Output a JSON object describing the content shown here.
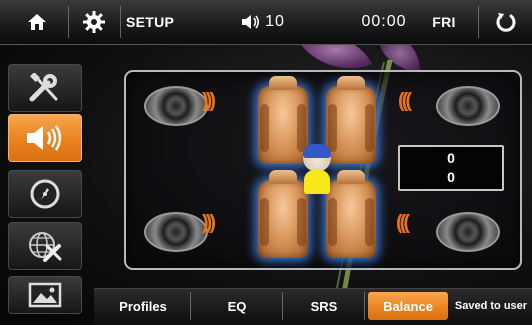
{
  "topbar": {
    "home_icon": "home-icon",
    "gear_icon": "gear-icon",
    "title": "SETUP",
    "volume_icon": "speaker-volume-icon",
    "volume_value": "10",
    "time": "00:00",
    "day": "FRI",
    "back_icon": "back-arrow-icon"
  },
  "sidebar": {
    "items": [
      {
        "name": "tools",
        "icon": "wrench-screwdriver-icon",
        "active": false
      },
      {
        "name": "audio",
        "icon": "speaker-icon",
        "active": true
      },
      {
        "name": "navigation",
        "icon": "compass-icon",
        "active": false
      },
      {
        "name": "system",
        "icon": "globe-tools-icon",
        "active": false
      },
      {
        "name": "display",
        "icon": "picture-icon",
        "active": false
      }
    ]
  },
  "balance": {
    "fader_value": "0",
    "balance_value": "0"
  },
  "tabs": [
    {
      "label": "Profiles",
      "active": false
    },
    {
      "label": "EQ",
      "active": false
    },
    {
      "label": "SRS",
      "active": false
    },
    {
      "label": "Balance",
      "active": true
    },
    {
      "label": "Saved to user",
      "active": false
    }
  ],
  "colors": {
    "accent": "#e9821f",
    "seat_glow": "#4a8cff"
  }
}
